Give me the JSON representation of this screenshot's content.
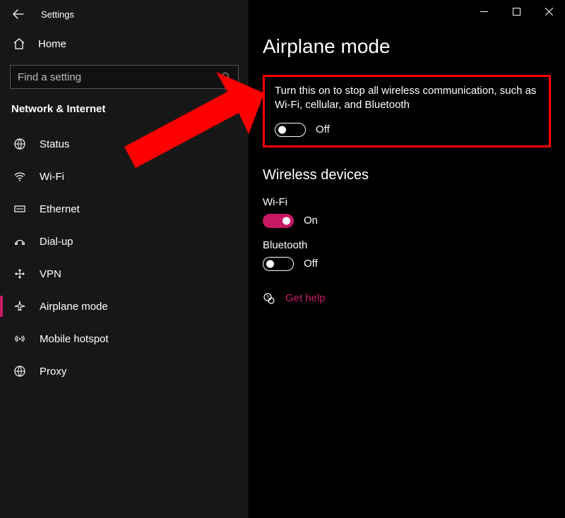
{
  "titlebar": {
    "title": "Settings"
  },
  "home": {
    "label": "Home"
  },
  "search": {
    "placeholder": "Find a setting"
  },
  "category": {
    "title": "Network & Internet"
  },
  "nav": {
    "items": [
      {
        "label": "Status"
      },
      {
        "label": "Wi-Fi"
      },
      {
        "label": "Ethernet"
      },
      {
        "label": "Dial-up"
      },
      {
        "label": "VPN"
      },
      {
        "label": "Airplane mode"
      },
      {
        "label": "Mobile hotspot"
      },
      {
        "label": "Proxy"
      }
    ]
  },
  "page": {
    "title": "Airplane mode",
    "description": "Turn this on to stop all wireless communication, such as Wi-Fi, cellular, and Bluetooth",
    "airplane_toggle_state": "Off",
    "wireless_section_title": "Wireless devices",
    "wifi": {
      "label": "Wi-Fi",
      "state": "On"
    },
    "bluetooth": {
      "label": "Bluetooth",
      "state": "Off"
    },
    "help": {
      "label": "Get help"
    }
  },
  "colors": {
    "accent": "#c71864",
    "highlight_border": "#ff0000"
  }
}
